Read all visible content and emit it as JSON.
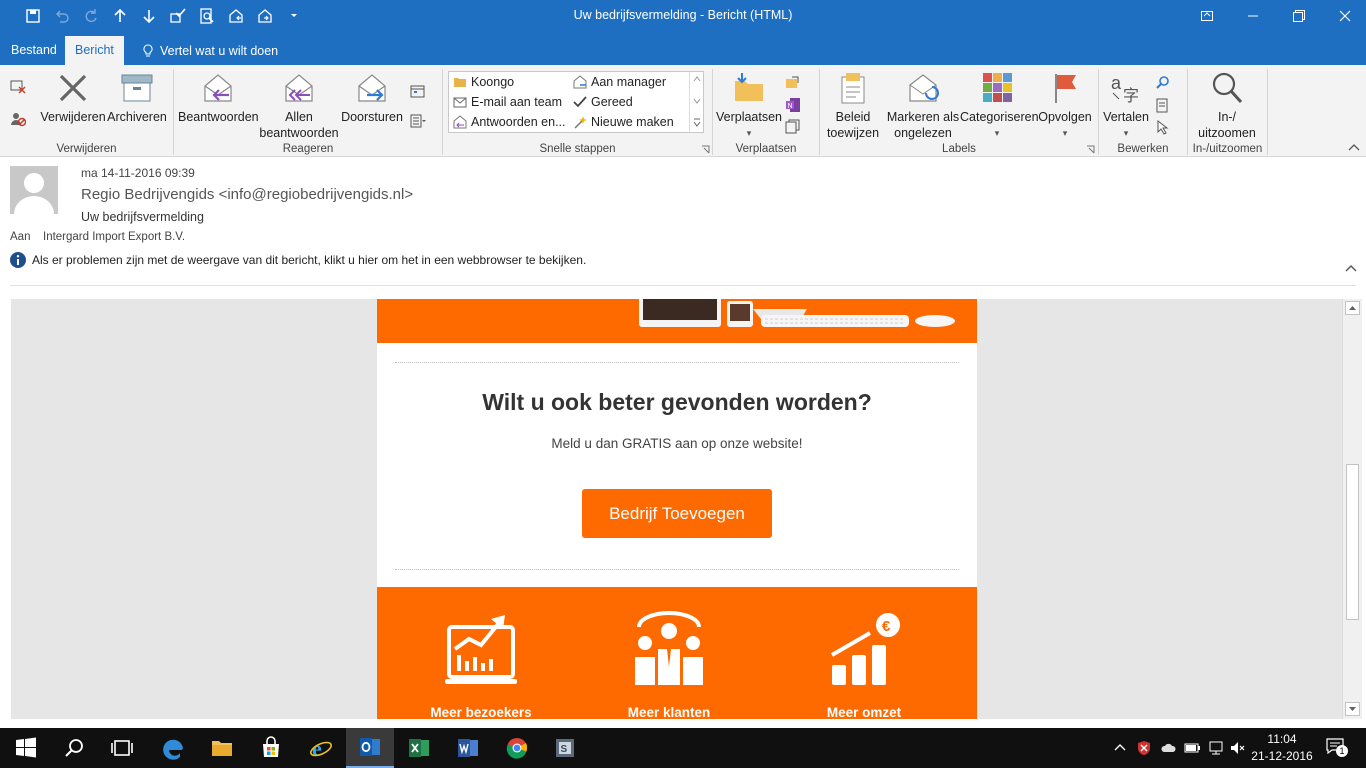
{
  "window": {
    "title": "Uw bedrijfsvermelding  -  Bericht (HTML)"
  },
  "tabs": {
    "file": "Bestand",
    "message": "Bericht",
    "tell_me": "Vertel wat u wilt doen"
  },
  "ribbon": {
    "delete_group": {
      "label": "Verwijderen",
      "delete": "Verwijderen",
      "archive": "Archiveren"
    },
    "respond_group": {
      "label": "Reageren",
      "reply": "Beantwoorden",
      "reply_all_line1": "Allen",
      "reply_all_line2": "beantwoorden",
      "forward": "Doorsturen"
    },
    "quick_steps": {
      "label": "Snelle stappen",
      "items": [
        "Koongo",
        "Aan manager",
        "E-mail aan team",
        "Gereed",
        "Antwoorden en...",
        "Nieuwe maken"
      ]
    },
    "move_group": {
      "label": "Verplaatsen",
      "move": "Verplaatsen"
    },
    "tags_group": {
      "label": "Labels",
      "policy_line1": "Beleid",
      "policy_line2": "toewijzen",
      "mark_unread_line1": "Markeren als",
      "mark_unread_line2": "ongelezen",
      "categorize": "Categoriseren",
      "follow_up": "Opvolgen"
    },
    "edit_group": {
      "label": "Bewerken",
      "translate": "Vertalen"
    },
    "zoom_group": {
      "label": "In-/uitzoomen",
      "zoom_line1": "In-/",
      "zoom_line2": "uitzoomen"
    }
  },
  "message": {
    "date": "ma 14-11-2016 09:39",
    "from": "Regio Bedrijvengids <info@regiobedrijvengids.nl>",
    "subject": "Uw bedrijfsvermelding",
    "to_label": "Aan",
    "to": "Intergard Import Export B.V.",
    "info": "Als er problemen zijn met de weergave van dit bericht, klikt u hier om het in een webbrowser te bekijken."
  },
  "email_body": {
    "headline": "Wilt u ook beter gevonden worden?",
    "subline": "Meld u dan GRATIS aan op onze website!",
    "cta": "Bedrijf Toevoegen",
    "features": [
      "Meer bezoekers",
      "Meer klanten",
      "Meer omzet"
    ]
  },
  "taskbar": {
    "time": "11:04",
    "date": "21-12-2016",
    "notifications": "1"
  },
  "colors": {
    "office_blue": "#1e6fc1",
    "brand_orange": "#ff6a00"
  }
}
